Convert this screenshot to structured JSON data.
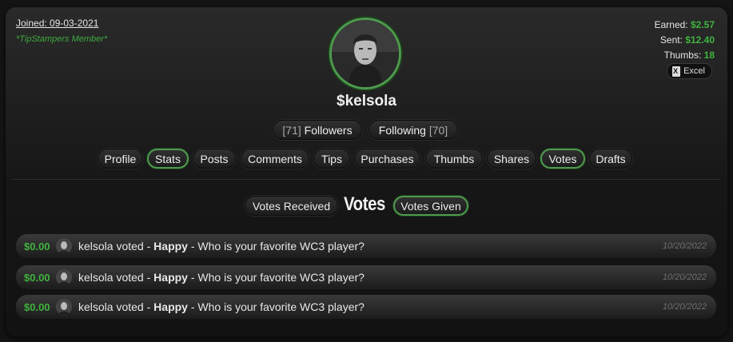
{
  "profile": {
    "joined": "Joined: 09-03-2021",
    "member_badge": "*TipStampers Member*",
    "username": "$kelsola",
    "earned_label": "Earned:",
    "earned_value": "$2.57",
    "sent_label": "Sent:",
    "sent_value": "$12.40",
    "thumbs_label": "Thumbs:",
    "thumbs_value": "18",
    "excel_label": "Excel"
  },
  "follow": {
    "followers_count": "[71]",
    "followers_label": "Followers",
    "following_label": "Following",
    "following_count": "[70]"
  },
  "tabs": [
    {
      "label": "Profile"
    },
    {
      "label": "Stats"
    },
    {
      "label": "Posts"
    },
    {
      "label": "Comments"
    },
    {
      "label": "Tips"
    },
    {
      "label": "Purchases"
    },
    {
      "label": "Thumbs"
    },
    {
      "label": "Shares"
    },
    {
      "label": "Votes"
    },
    {
      "label": "Drafts"
    }
  ],
  "votes": {
    "title": "Votes",
    "received_label": "Votes Received",
    "given_label": "Votes Given",
    "rows": [
      {
        "amount": "$0.00",
        "text_pre": "kelsola voted - ",
        "mood": "Happy",
        "text_post": " - Who is your favorite WC3 player?",
        "date": "10/20/2022"
      },
      {
        "amount": "$0.00",
        "text_pre": "kelsola voted - ",
        "mood": "Happy",
        "text_post": " - Who is your favorite WC3 player?",
        "date": "10/20/2022"
      },
      {
        "amount": "$0.00",
        "text_pre": "kelsola voted - ",
        "mood": "Happy",
        "text_post": " - Who is your favorite WC3 player?",
        "date": "10/20/2022"
      }
    ]
  },
  "colors": {
    "accent_green": "#3fb43f",
    "active_ring": "#4e9a4e",
    "background": "#141414"
  }
}
